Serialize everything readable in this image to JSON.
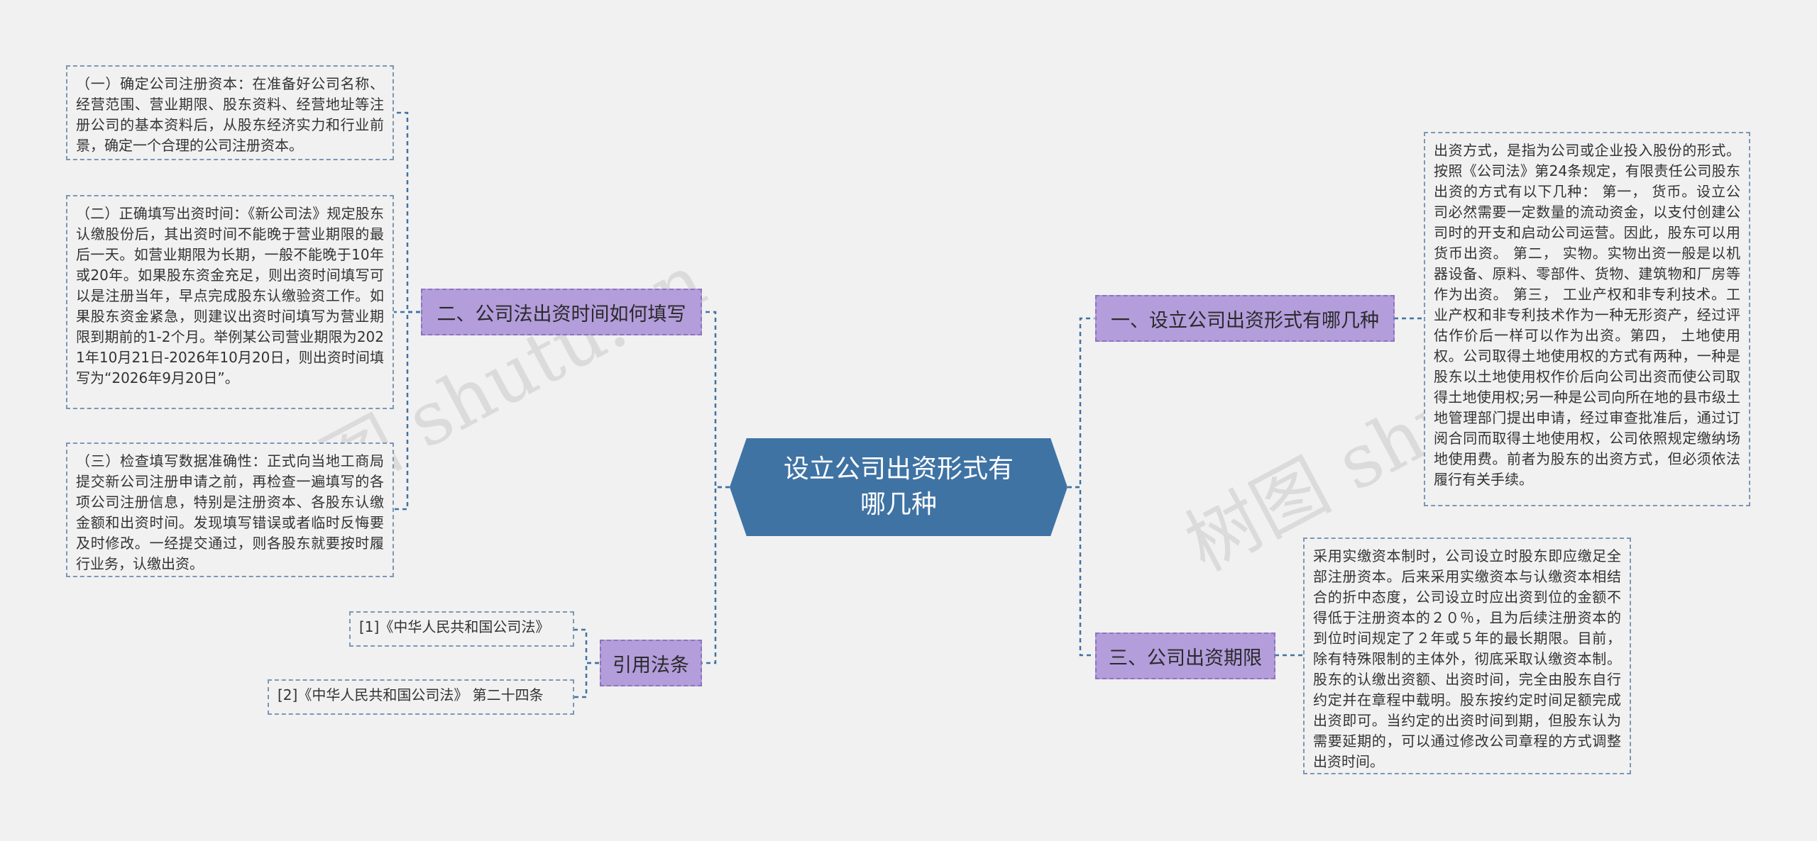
{
  "central": {
    "label": "设立公司出资形式有哪几种"
  },
  "topics": {
    "r1": {
      "label": "一、设立公司出资形式有哪几种",
      "detail": "出资方式，是指为公司或企业投入股份的形式。 按照《公司法》第24条规定，有限责任公司股东出资的方式有以下几种： 第一， 货币。设立公司必然需要一定数量的流动资金，以支付创建公司时的开支和启动公司运营。因此，股东可以用货币出资。 第二， 实物。实物出资一般是以机器设备、原料、零部件、货物、建筑物和厂房等作为出资。 第三， 工业产权和非专利技术。工业产权和非专利技术作为一种无形资产，经过评估作价后一样可以作为出资。第四， 土地使用权。公司取得土地使用权的方式有两种，一种是股东以土地使用权作价后向公司出资而使公司取得土地使用权;另一种是公司向所在地的县市级土地管理部门提出申请，经过审查批准后，通过订阅合同而取得土地使用权，公司依照规定缴纳场地使用费。前者为股东的出资方式，但必须依法履行有关手续。"
    },
    "r2": {
      "label": "三、公司出资期限",
      "detail": "采用实缴资本制时，公司设立时股东即应缴足全部注册资本。后来采用实缴资本与认缴资本相结合的折中态度，公司设立时应出资到位的金额不得低于注册资本的２０％，且为后续注册资本的到位时间规定了２年或５年的最长期限。目前，除有特殊限制的主体外，彻底采取认缴资本制。股东的认缴出资额、出资时间，完全由股东自行约定并在章程中载明。股东按约定时间足额完成出资即可。当约定的出资时间到期，但股东认为需要延期的，可以通过修改公司章程的方式调整出资时间。"
    },
    "l1": {
      "label": "二、公司法出资时间如何填写",
      "items": [
        "（一）确定公司注册资本：在准备好公司名称、经营范围、营业期限、股东资料、经营地址等注册公司的基本资料后，从股东经济实力和行业前景，确定一个合理的公司注册资本。",
        "（二）正确填写出资时间：《新公司法》规定股东认缴股份后，其出资时间不能晚于营业期限的最后一天。如营业期限为长期，一般不能晚于10年或20年。如果股东资金充足，则出资时间填写可以是注册当年，早点完成股东认缴验资工作。如果股东资金紧急，则建议出资时间填写为营业期限到期前的1-2个月。举例某公司营业期限为2021年10月21日-2026年10月20日，则出资时间填写为“2026年9月20日”。",
        "（三）检查填写数据准确性：正式向当地工商局提交新公司注册申请之前，再检查一遍填写的各项公司注册信息，特别是注册资本、各股东认缴金额和出资时间。发现填写错误或者临时反悔要及时修改。一经提交通过，则各股东就要按时履行业务，认缴出资。"
      ]
    },
    "l2": {
      "label": "引用法条",
      "items": [
        "[1]《中华人民共和国公司法》",
        "[2]《中华人民共和国公司法》 第二十四条"
      ]
    }
  },
  "watermarks": [
    "树图 shutu.cn",
    "树图 shutu.cn"
  ],
  "colors": {
    "background": "#f1f1f1",
    "central_fill": "#3f73a4",
    "topic_fill": "#b39ddb",
    "connector": "#3f73a4",
    "leaf_border": "#7b97b5"
  }
}
